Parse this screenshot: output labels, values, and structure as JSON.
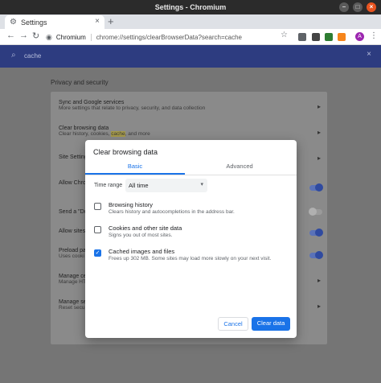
{
  "window": {
    "title": "Settings - Chromium"
  },
  "tabs": [
    {
      "label": "Settings"
    }
  ],
  "toolbar": {
    "site_chip": "Chromium",
    "url": "chrome://settings/clearBrowserData?search=cache",
    "avatar_letter": "A"
  },
  "search": {
    "query": "cache"
  },
  "settings": {
    "section_title": "Privacy and security",
    "rows": [
      {
        "title": "Sync and Google services",
        "sub": "More settings that relate to privacy, security, and data collection"
      },
      {
        "title": "Clear browsing data",
        "sub_before": "Clear history, cookies, ",
        "sub_highlight": "cache",
        "sub_after": ", and more"
      },
      {
        "title": "Site Settings"
      },
      {
        "title": "Allow Chrom"
      },
      {
        "title": "Send a \"Do"
      },
      {
        "title": "Allow sites"
      },
      {
        "title": "Preload pa",
        "sub": "Uses cooki"
      },
      {
        "title": "Manage ce",
        "sub": "Manage HT"
      },
      {
        "title": "Manage se",
        "sub": "Reset secu"
      }
    ]
  },
  "dialog": {
    "title": "Clear browsing data",
    "tabs": {
      "basic": "Basic",
      "advanced": "Advanced"
    },
    "time_range_label": "Time range",
    "time_range_value": "All time",
    "options": [
      {
        "title": "Browsing history",
        "sub": "Clears history and autocompletions in the address bar.",
        "checked": false
      },
      {
        "title": "Cookies and other site data",
        "sub": "Signs you out of most sites.",
        "checked": false
      },
      {
        "title": "Cached images and files",
        "sub": "Frees up 302 MB. Some sites may load more slowly on your next visit.",
        "checked": true
      }
    ],
    "cancel_label": "Cancel",
    "confirm_label": "Clear data"
  },
  "colors": {
    "accent": "#1a73e8",
    "header": "#2d3c80",
    "titlebar": "#2b2b2b"
  }
}
